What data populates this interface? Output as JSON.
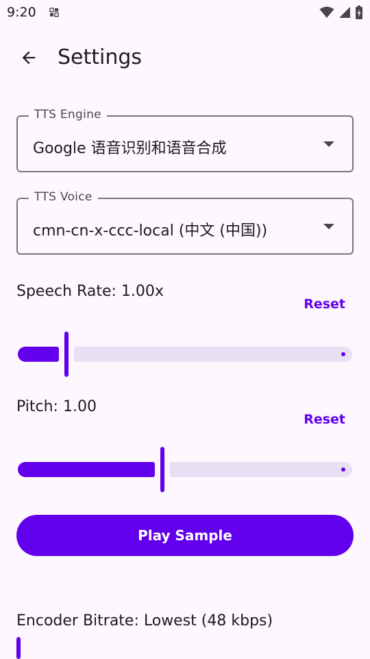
{
  "status_bar": {
    "time": "9:20",
    "icons": [
      "notification-grid-icon",
      "wifi-icon",
      "cellular-signal-icon",
      "battery-charging-icon"
    ]
  },
  "app_bar": {
    "back_icon": "arrow-back-icon",
    "title": "Settings"
  },
  "tts_engine": {
    "label": "TTS Engine",
    "value": "Google 语音识别和语音合成"
  },
  "tts_voice": {
    "label": "TTS Voice",
    "value": "cmn-cn-x-ccc-local (中文 (中国))"
  },
  "speech_rate": {
    "label": "Speech Rate: 1.00x",
    "reset_label": "Reset",
    "value_fraction": 0.14
  },
  "pitch": {
    "label": "Pitch: 1.00",
    "reset_label": "Reset",
    "value_fraction": 0.43
  },
  "play_sample": {
    "label": "Play Sample"
  },
  "encoder_bitrate": {
    "label": "Encoder Bitrate: Lowest (48 kbps)",
    "value_fraction": 0
  },
  "colors": {
    "accent": "#6200ee",
    "track_inactive": "#e8dff5",
    "background": "#fdf7fe",
    "outline": "#79747e"
  }
}
